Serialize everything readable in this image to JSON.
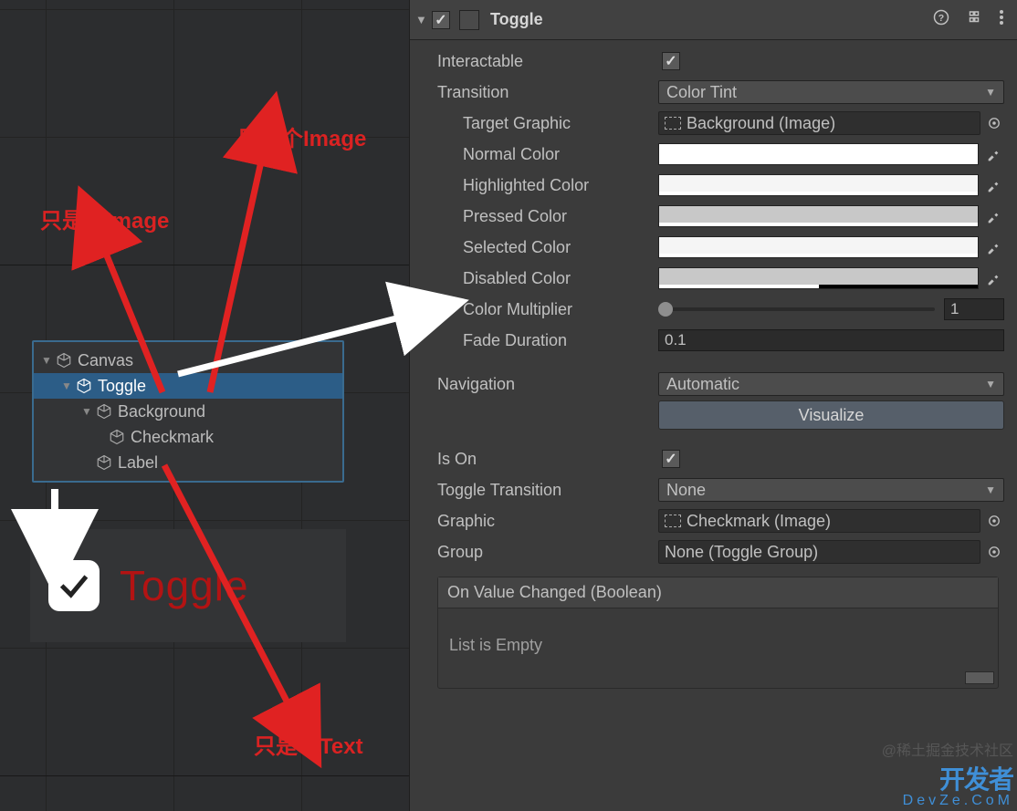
{
  "annotations": {
    "imageNote1": "只是个Image",
    "imageNote2": "只是个Image",
    "textNote": "只是个Text"
  },
  "hierarchy": {
    "items": [
      {
        "label": "Canvas"
      },
      {
        "label": "Toggle"
      },
      {
        "label": "Background"
      },
      {
        "label": "Checkmark"
      },
      {
        "label": "Label"
      }
    ]
  },
  "preview": {
    "label": "Toggle"
  },
  "inspector": {
    "title": "Toggle",
    "interactable": {
      "label": "Interactable",
      "checked": true
    },
    "transition": {
      "label": "Transition",
      "value": "Color Tint"
    },
    "targetGraphic": {
      "label": "Target Graphic",
      "value": "Background (Image)"
    },
    "normalColor": {
      "label": "Normal Color",
      "hex": "#ffffff",
      "alpha": 100
    },
    "highlightedColor": {
      "label": "Highlighted Color",
      "hex": "#f5f5f5",
      "alpha": 100
    },
    "pressedColor": {
      "label": "Pressed Color",
      "hex": "#c8c8c8",
      "alpha": 100
    },
    "selectedColor": {
      "label": "Selected Color",
      "hex": "#f5f5f5",
      "alpha": 100
    },
    "disabledColor": {
      "label": "Disabled Color",
      "hex": "#c8c8c8",
      "alpha": 50
    },
    "colorMultiplier": {
      "label": "Color Multiplier",
      "value": "1"
    },
    "fadeDuration": {
      "label": "Fade Duration",
      "value": "0.1"
    },
    "navigation": {
      "label": "Navigation",
      "value": "Automatic"
    },
    "visualize": "Visualize",
    "isOn": {
      "label": "Is On",
      "checked": true
    },
    "toggleTransition": {
      "label": "Toggle Transition",
      "value": "None"
    },
    "graphic": {
      "label": "Graphic",
      "value": "Checkmark (Image)"
    },
    "group": {
      "label": "Group",
      "value": "None (Toggle Group)"
    },
    "onValueChanged": {
      "header": "On Value Changed (Boolean)",
      "empty": "List is Empty"
    }
  },
  "watermark": {
    "line1": "@稀土掘金技术社区",
    "line2": "开发者",
    "line3": "DevZe.CoM"
  }
}
